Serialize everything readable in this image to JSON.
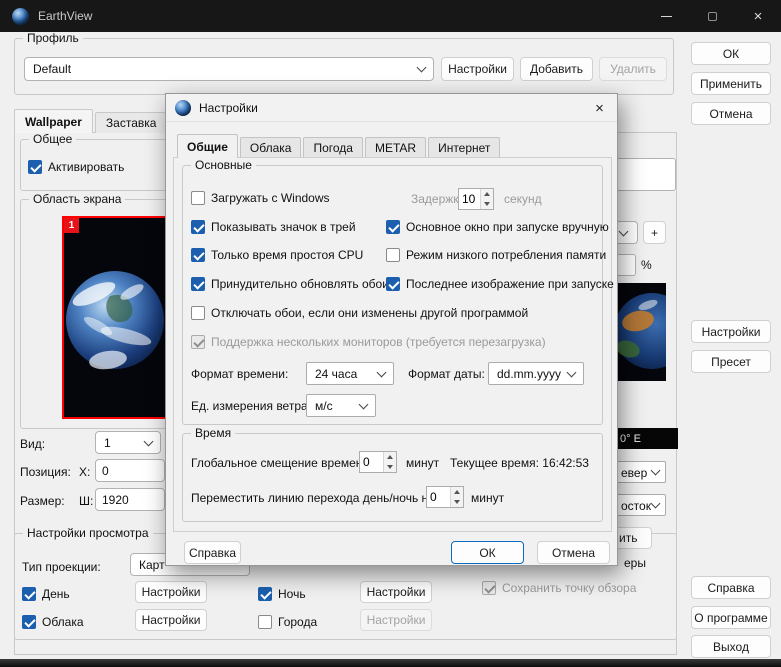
{
  "colors": {
    "accent": "#1b5fae",
    "preview_border": "#ff0000",
    "titlebar_bg": "#171717"
  },
  "window": {
    "title": "EarthView",
    "controls": {
      "close": "×"
    }
  },
  "main": {
    "profile": {
      "label": "Профиль",
      "value": "Default",
      "settings": "Настройки",
      "add": "Добавить",
      "remove": "Удалить"
    },
    "actions": {
      "ok": "ОК",
      "apply": "Применить",
      "cancel": "Отмена",
      "settings": "Настройки",
      "preset": "Пресет",
      "help": "Справка",
      "about": "О программе",
      "exit": "Выход"
    },
    "tabs": {
      "wallpaper": "Wallpaper",
      "screensaver": "Заставка"
    },
    "general": {
      "label": "Общее",
      "activate": "Активировать"
    },
    "screen_area": {
      "label": "Область экрана",
      "monitor_number": "1"
    },
    "view": {
      "label": "Вид:",
      "value": "1"
    },
    "position": {
      "label": "Позиция:",
      "x_label": "X:",
      "x_value": "0"
    },
    "size": {
      "label": "Размер:",
      "w_label": "Ш:",
      "w_value": "1920"
    },
    "view_settings": {
      "label": "Настройки просмотра",
      "projection_label": "Тип проекции:",
      "projection_value": "Карт",
      "day": "День",
      "night": "Ночь",
      "clouds": "Облака",
      "cities": "Города",
      "settings": "Настройки"
    },
    "right_panel": {
      "plus": "+",
      "percent": "%",
      "coords": "0° E",
      "north_partial": "евер",
      "east_partial": "осток",
      "button_partial": "ить",
      "label_partial": "еры",
      "save_view": "Сохранить точку обзора"
    }
  },
  "dialog": {
    "title": "Настройки",
    "close_glyph": "×",
    "tabs": [
      "Общие",
      "Облака",
      "Погода",
      "METAR",
      "Интернет"
    ],
    "general": {
      "label": "Основные",
      "load_with_windows": "Загружать с Windows",
      "delay_label": "Задержка:",
      "delay_value": "10",
      "delay_unit": "секунд",
      "tray_icon": "Показывать значок в трей",
      "main_window_manual": "Основное окно при запуске вручную",
      "cpu_idle": "Только время простоя CPU",
      "low_memory": "Режим низкого потребления памяти",
      "force_refresh": "Принудительно обновлять обои",
      "last_image": "Последнее изображение при запуске",
      "disable_wallpaper": "Отключать обои, если они изменены другой программой",
      "multi_monitor": "Поддержка нескольких мониторов (требуется перезагрузка)",
      "time_format_label": "Формат времени:",
      "time_format_value": "24 часа",
      "date_format_label": "Формат даты:",
      "date_format_value": "dd.mm.yyyy",
      "wind_unit_label": "Ед. измерения ветра:",
      "wind_unit_value": "м/с"
    },
    "time": {
      "label": "Время",
      "offset_label": "Глобальное смещение времени:",
      "offset_value": "0",
      "offset_unit": "минут",
      "current_time": "Текущее время: 16:42:53",
      "terminator_label": "Переместить линию перехода день/ночь на:",
      "terminator_value": "0",
      "terminator_unit": "минут"
    },
    "buttons": {
      "help": "Справка",
      "ok": "ОК",
      "cancel": "Отмена"
    }
  }
}
